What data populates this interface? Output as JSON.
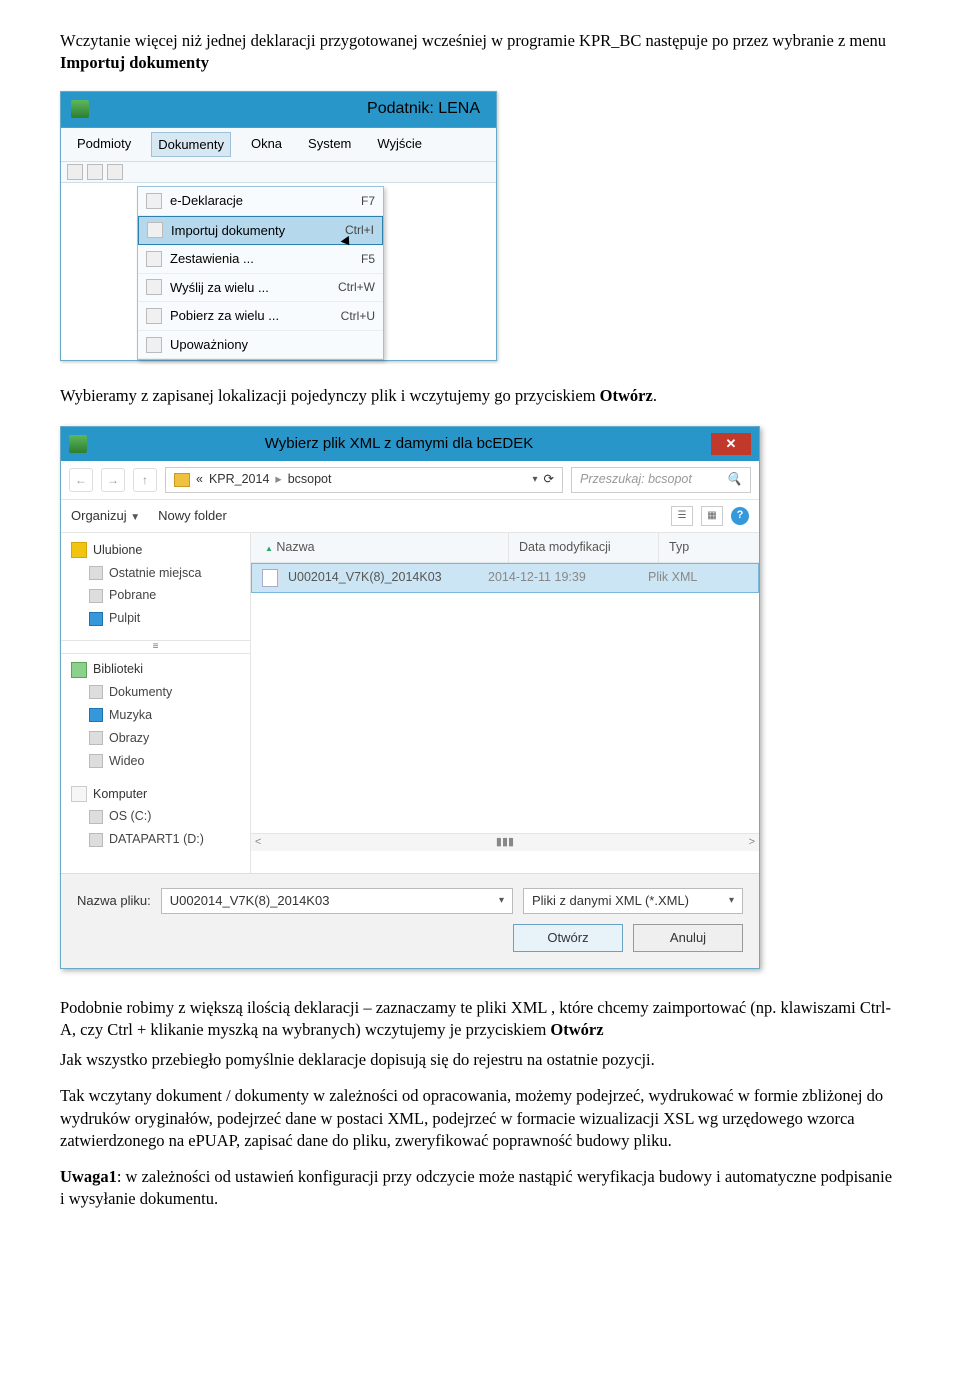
{
  "para1_a": "Wczytanie więcej niż jednej deklaracji przygotowanej wcześniej w programie KPR_BC następuje po przez  wybranie z menu ",
  "para1_bold": "Importuj dokumenty",
  "menu_window": {
    "title": "Podatnik: LENA",
    "menubar": [
      "Podmioty",
      "Dokumenty",
      "Okna",
      "System",
      "Wyjście"
    ],
    "dropdown": [
      {
        "label": "e-Deklaracje",
        "shortcut": "F7"
      },
      {
        "label": "Importuj dokumenty",
        "shortcut": "Ctrl+I"
      },
      {
        "label": "Zestawienia ...",
        "shortcut": "F5"
      },
      {
        "label": "Wyślij za wielu ...",
        "shortcut": "Ctrl+W"
      },
      {
        "label": "Pobierz za wielu ...",
        "shortcut": "Ctrl+U"
      },
      {
        "label": "Upoważniony",
        "shortcut": ""
      }
    ]
  },
  "para2_a": "Wybieramy z zapisanej lokalizacji pojedynczy plik i wczytujemy go przyciskiem ",
  "para2_bold": "Otwórz",
  "para2_b": ".",
  "file_dialog": {
    "title": "Wybierz plik XML z damymi dla bcEDEK",
    "path_prefix": "«",
    "path_seg1": "KPR_2014",
    "path_seg2": "bcsopot",
    "search_placeholder": "Przeszukaj: bcsopot",
    "organize": "Organizuj",
    "new_folder": "Nowy folder",
    "tree": {
      "fav_head": "Ulubione",
      "fav_items": [
        "Ostatnie miejsca",
        "Pobrane",
        "Pulpit"
      ],
      "lib_head": "Biblioteki",
      "lib_items": [
        "Dokumenty",
        "Muzyka",
        "Obrazy",
        "Wideo"
      ],
      "comp_head": "Komputer",
      "comp_items": [
        "OS (C:)",
        "DATAPART1 (D:)"
      ]
    },
    "list": {
      "col_name": "Nazwa",
      "col_date": "Data modyfikacji",
      "col_type": "Typ",
      "row_name": "U002014_V7K(8)_2014K03",
      "row_date": "2014-12-11 19:39",
      "row_type": "Plik XML"
    },
    "fn_label": "Nazwa pliku:",
    "fn_value": "U002014_V7K(8)_2014K03",
    "type_filter": "Pliki z danymi  XML (*.XML)",
    "btn_open": "Otwórz",
    "btn_cancel": "Anuluj"
  },
  "para3": "Podobnie robimy z  większą ilością deklaracji – zaznaczamy te pliki XML ,  które chcemy zaimportować (np. klawiszami Ctrl-A, czy  Ctrl + klikanie myszką na wybranych) wczytujemy je przyciskiem ",
  "para3_bold": "Otwórz",
  "para3b": "Jak wszystko przebiegło pomyślnie deklaracje dopisują się do rejestru na ostatnie pozycji.",
  "para4": "Tak wczytany dokument / dokumenty w zależności od opracowania, możemy podejrzeć, wydrukować w formie zbliżonej do wydruków oryginałów, podejrzeć dane w postaci XML, podejrzeć w formacie wizualizacji XSL wg urzędowego wzorca zatwierdzonego na ePUAP, zapisać dane do pliku, zweryfikować poprawność budowy pliku.",
  "para5_bold": "Uwaga1",
  "para5_a": ": w zależności od ustawień konfiguracji przy odczycie może nastąpić weryfikacja budowy i automatyczne podpisanie i wysyłanie dokumentu."
}
